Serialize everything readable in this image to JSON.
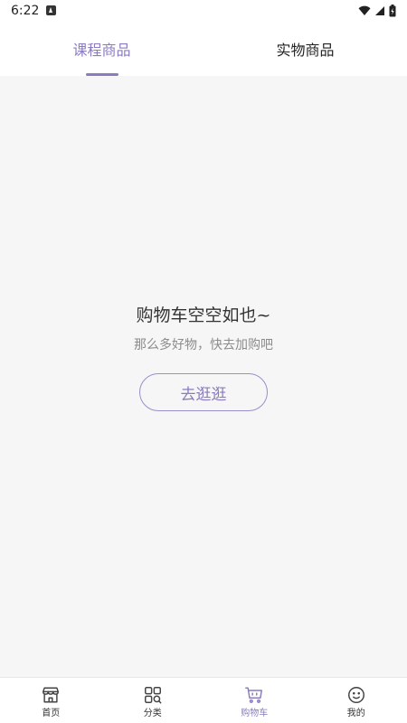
{
  "status_bar": {
    "time": "6:22",
    "icons": [
      "app-notification-icon",
      "wifi-icon",
      "signal-icon",
      "battery-icon"
    ]
  },
  "tabs": [
    {
      "label": "课程商品",
      "active": true
    },
    {
      "label": "实物商品",
      "active": false
    }
  ],
  "empty_state": {
    "title": "购物车空空如也~",
    "subtitle": "那么多好物，快去加购吧",
    "button_label": "去逛逛"
  },
  "bottom_nav": [
    {
      "label": "首页",
      "icon": "store-icon",
      "active": false
    },
    {
      "label": "分类",
      "icon": "category-grid-icon",
      "active": false
    },
    {
      "label": "购物车",
      "icon": "cart-icon",
      "active": true
    },
    {
      "label": "我的",
      "icon": "smiley-icon",
      "active": false
    }
  ],
  "colors": {
    "accent": "#8a7cbf",
    "background": "#f6f6f6",
    "surface": "#ffffff",
    "text_primary": "#333333",
    "text_secondary": "#8c8c8c"
  }
}
